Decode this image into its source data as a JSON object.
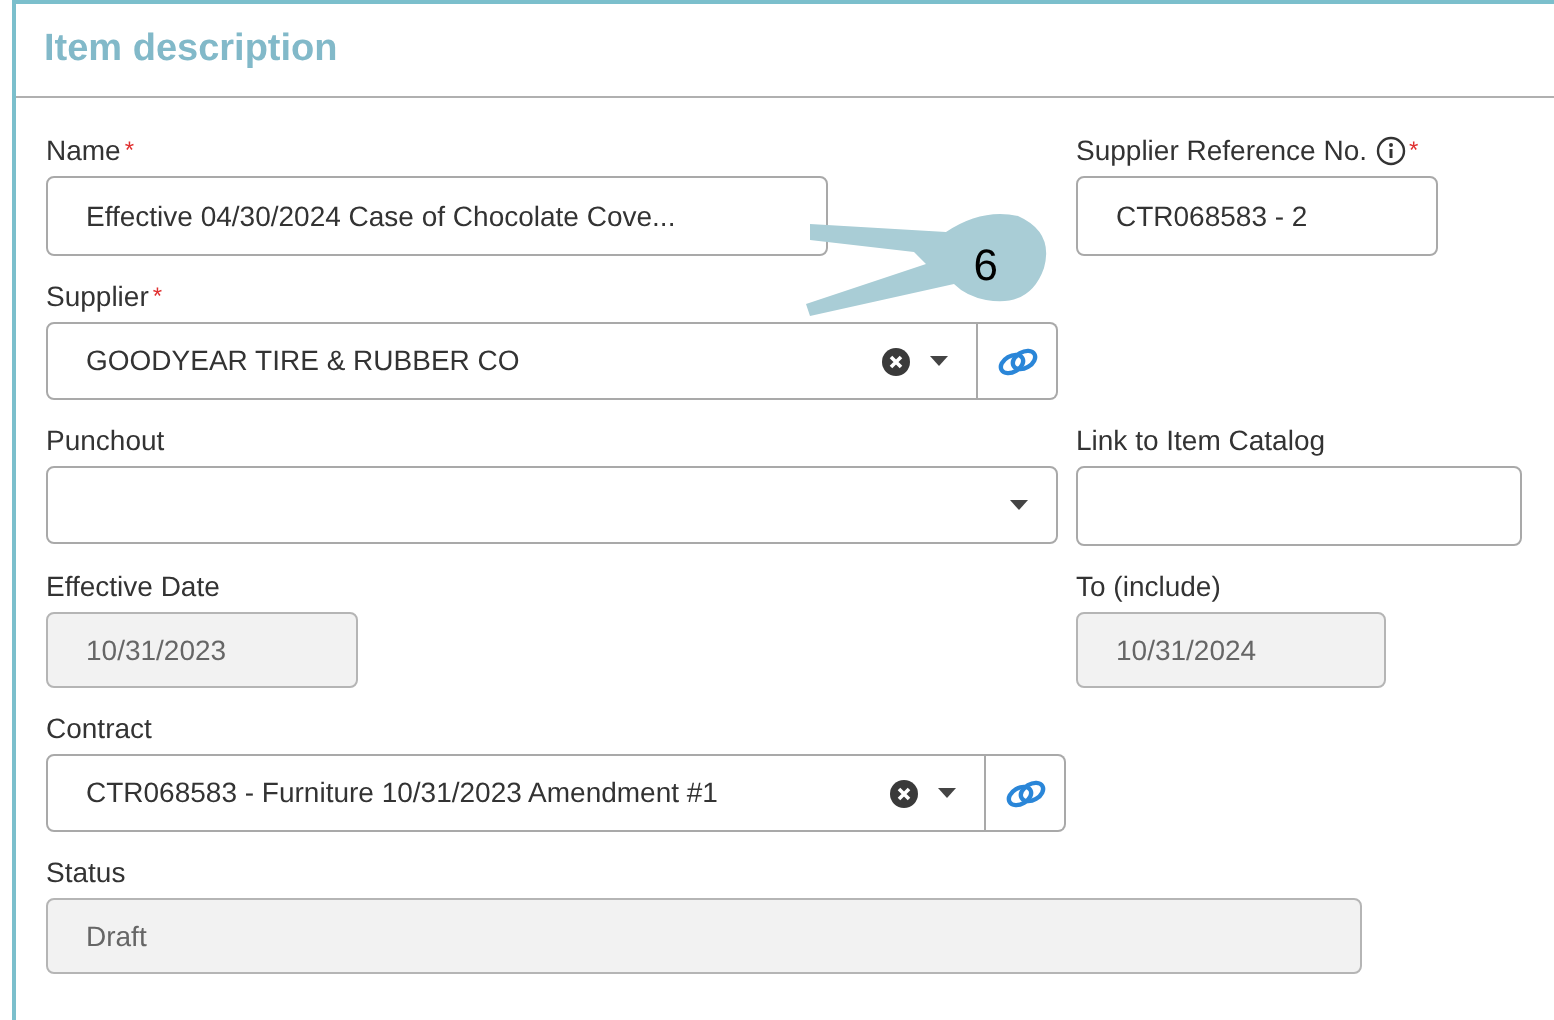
{
  "section": {
    "title": "Item description"
  },
  "rows": [
    [
      {
        "kind": "text",
        "label": "Name",
        "required_mark": "*",
        "value": "Effective 04/30/2024 Case of Chocolate Cove..."
      },
      {
        "kind": "text",
        "label": "Supplier Reference No.",
        "info": true,
        "required_mark": "*",
        "value": "CTR068583 - 2"
      }
    ],
    [
      {
        "kind": "select",
        "label": "Supplier",
        "required_mark": "*",
        "value": "GOODYEAR TIRE & RUBBER CO",
        "clearable": true,
        "link": true
      }
    ],
    [
      {
        "kind": "select",
        "label": "Punchout"
      },
      {
        "kind": "text",
        "label": "Link to Item Catalog"
      }
    ],
    [
      {
        "kind": "readonly",
        "label": "Effective Date",
        "value": "10/31/2023"
      },
      {
        "kind": "readonly",
        "label": "To (include)",
        "value": "10/31/2024"
      }
    ],
    [
      {
        "kind": "select",
        "label": "Contract",
        "value": "CTR068583 - Furniture 10/31/2023 Amendment #1",
        "clearable": true,
        "link": true
      }
    ],
    [
      {
        "kind": "readonly",
        "label": "Status",
        "value": "Draft"
      }
    ]
  ],
  "callout": {
    "number": "6"
  }
}
